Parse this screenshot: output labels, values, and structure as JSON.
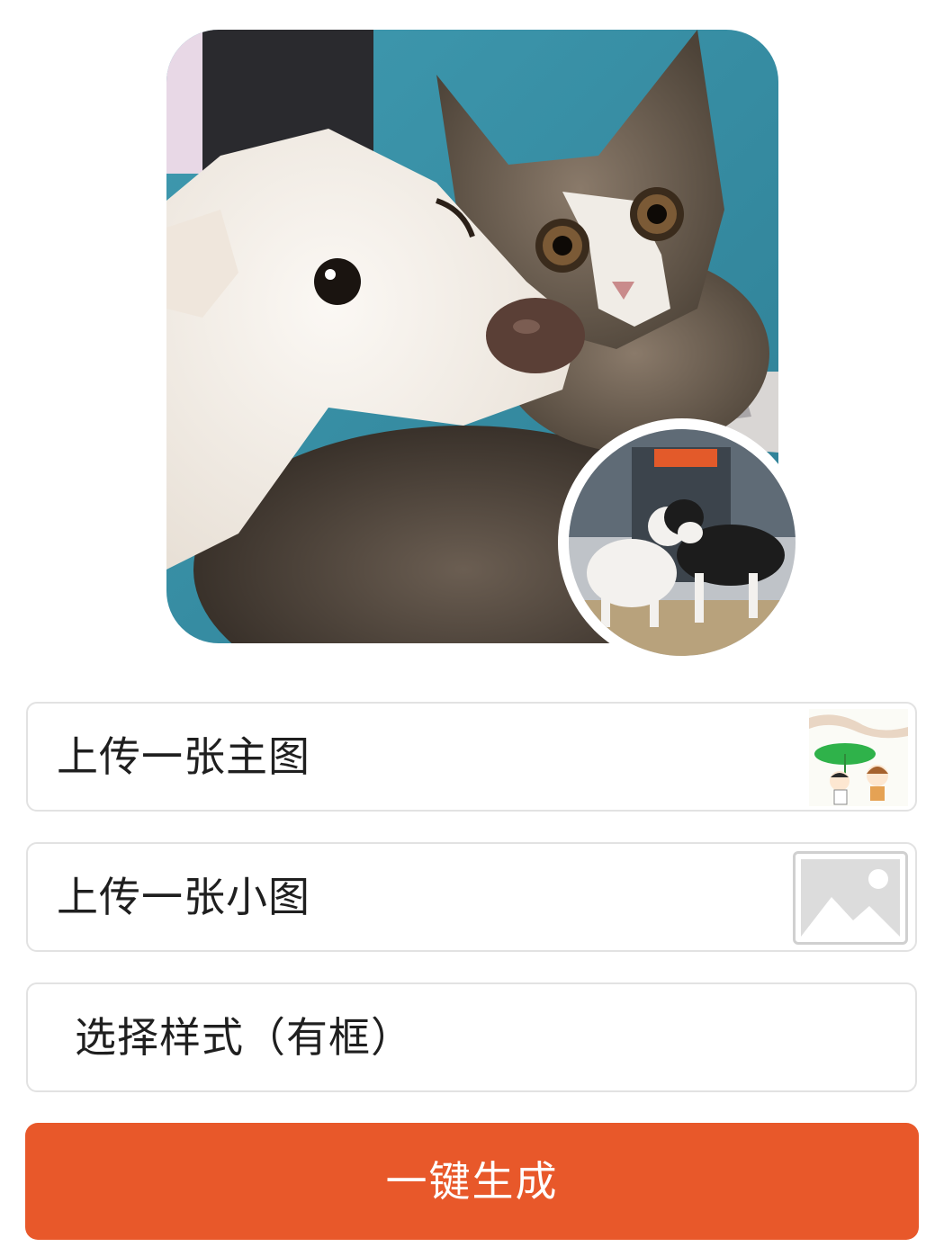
{
  "preview": {
    "main_image": "dog-and-cat-photo",
    "small_image": "two-cats-photo"
  },
  "form": {
    "main_upload_label": "上传一张主图",
    "main_upload_thumb": "umbrella-leaf-cartoon-thumbnail",
    "small_upload_label": "上传一张小图",
    "small_upload_thumb": "image-placeholder-icon",
    "style_label": "选择样式（有框）"
  },
  "actions": {
    "generate_label": "一键生成"
  },
  "colors": {
    "accent": "#e8582a",
    "border": "#e2e2e2",
    "text": "#1f1f1f"
  }
}
